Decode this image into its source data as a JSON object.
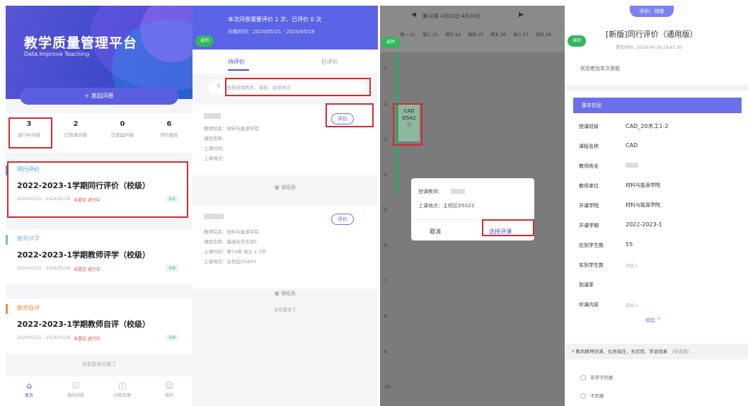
{
  "panel1": {
    "title": "教学质量管理平台",
    "subtitle": "Data Improve Teaching",
    "add_button": "+ 发起问卷",
    "stats": [
      {
        "count": "3",
        "label": "进行中问卷"
      },
      {
        "count": "2",
        "label": "已结束问卷"
      },
      {
        "count": "0",
        "label": "已发起问卷"
      },
      {
        "count": "6",
        "label": "评价报告"
      }
    ],
    "cards": [
      {
        "category": "同行评价",
        "title": "2022-2023-1学期同行评价（校级）",
        "date": "2024/05/21 - 2024/05/28",
        "status": "未提交 进行中",
        "progress": "0/2",
        "color": "#3aa0e6"
      },
      {
        "category": "教师评学",
        "title": "2022-2023-1学期教师评学（校级）",
        "date": "2024/05/21 - 2024/05/28",
        "status": "未提交 进行中",
        "progress": "0/6",
        "color": "#7fb4e6"
      },
      {
        "category": "教师自评",
        "title": "2022-2023-1学期教师自评（校级）",
        "date": "2024/05/21 - 2024/05/28",
        "status": "未提交 进行中",
        "progress": "0/4",
        "color": "#f08a3c"
      }
    ],
    "bottom_note": "没有更多问卷了",
    "tabs": [
      {
        "label": "首页",
        "icon": "home-icon"
      },
      {
        "label": "我的问卷",
        "icon": "survey-icon"
      },
      {
        "label": "问卷反馈",
        "icon": "feedback-icon"
      },
      {
        "label": "我的",
        "icon": "user-icon"
      }
    ]
  },
  "panel2": {
    "header_line1": "本次问卷需要评价 2 次，已评价 0 次",
    "header_line2": "问卷时间：2024/05/21 - 2024/05/28",
    "back_label": "返回",
    "tab_pending": "待评价",
    "tab_done": "已评价",
    "search_placeholder": "搜索授课教师、课程、授课地点",
    "eval_button": "评价",
    "card1_lines": [
      "教师院系：材料与能源学院",
      "课程名称：",
      "上课时间：",
      "上课地点："
    ],
    "card1_more": "课程表",
    "card2_lines": [
      "教师院系：材料与能源学院",
      "课程名称：基础化学实验1",
      "上课时间：第14周 周五 2-3节",
      "上课地点：主校区D5A03"
    ],
    "card2_more": "课程表",
    "end_note": "没有更多了"
  },
  "panel3": {
    "week": "第10周 4月22日-4月28日",
    "back_label": "返回",
    "days": [
      "周一 22",
      "周二 23",
      "周三 24",
      "周四 25",
      "周五 26",
      "周六 27",
      "周日 28"
    ],
    "rows": [
      "1",
      "2",
      "3",
      "4",
      "5",
      "6",
      "7",
      "8",
      "9",
      "10"
    ],
    "cell_text": "CAD D5A2",
    "dialog_teacher": "授课教师：",
    "dialog_place": "上课地点：主校区D5S23",
    "dialog_cancel": "取消",
    "dialog_choose": "选择评课"
  },
  "panel4": {
    "badge": "评价：待提",
    "back_label": "返回",
    "title": "[新版]同行评价（通用版）",
    "time": "提交时间：2024-04-16 19:47:20",
    "welcome": "欢迎参加本次答题",
    "section": "基本信息",
    "fields": [
      {
        "label": "授课班级",
        "value": "CAD_20木工1-2"
      },
      {
        "label": "课程名称",
        "value": "CAD"
      },
      {
        "label": "教师姓名",
        "value": ""
      },
      {
        "label": "教师单位",
        "value": "材料与能源学院"
      },
      {
        "label": "开课学院",
        "value": "材料与能源学院"
      },
      {
        "label": "开课学期",
        "value": "2022-2023-1"
      },
      {
        "label": "应到学生数",
        "value": "55"
      },
      {
        "label": "实到学生数",
        "value": "",
        "placeholder": "请输入"
      },
      {
        "label": "到课率",
        "value": ""
      },
      {
        "label": "听课内容",
        "value": "",
        "placeholder": "请输入"
      }
    ],
    "collapse": "收起 ^",
    "question": "* 教风精神饱满、仪表端庄，无迟到、早退现象",
    "question_tag": "（单选题）",
    "options": [
      "非常不同意",
      "不同意"
    ]
  }
}
